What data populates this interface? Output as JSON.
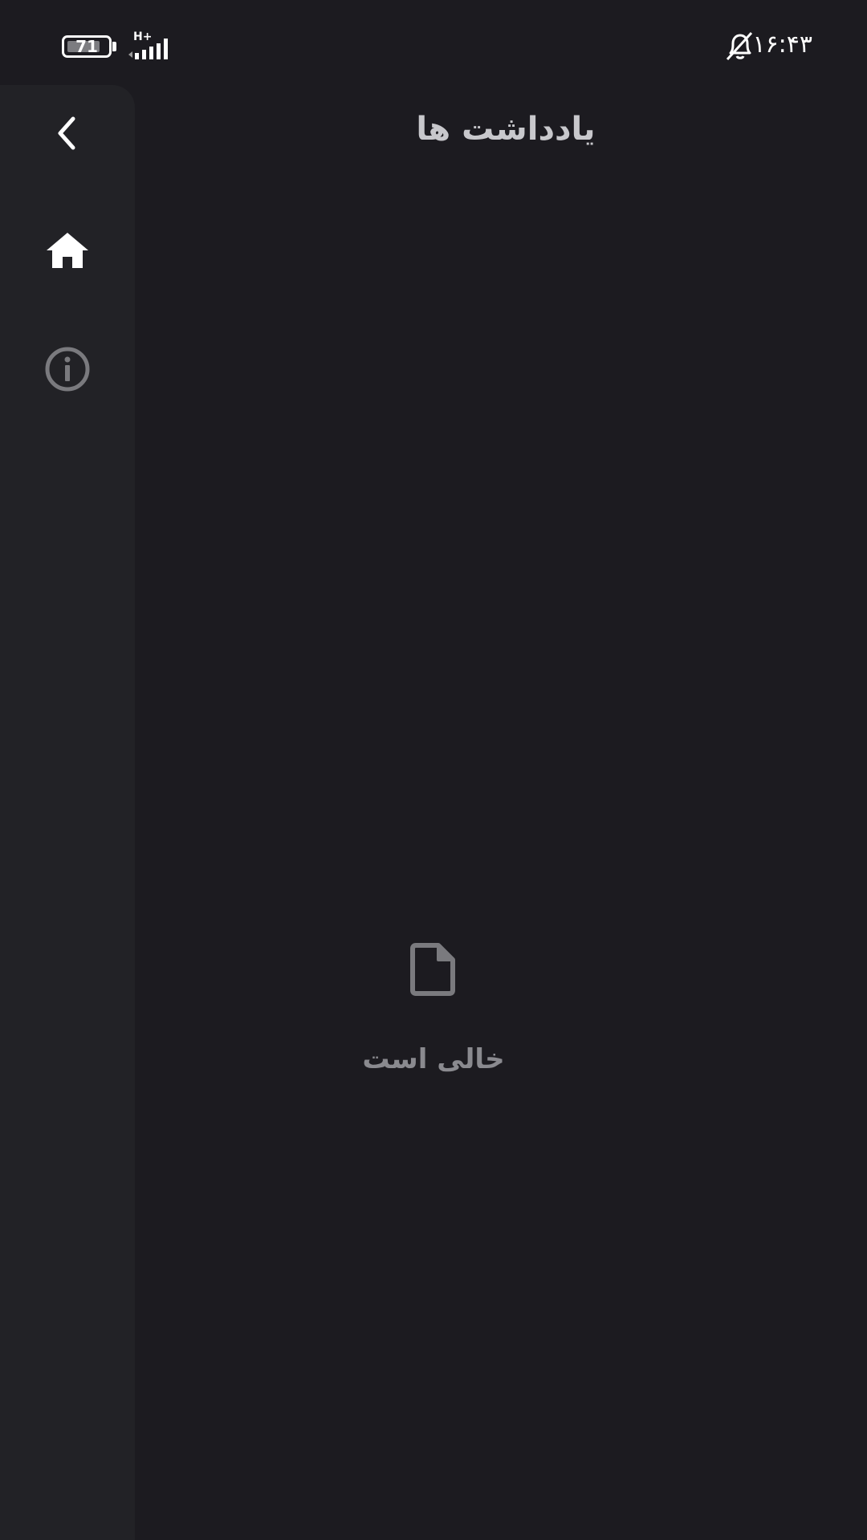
{
  "status_bar": {
    "battery_level": "71",
    "network_type": "H+",
    "time": "۱۶:۴۳",
    "icons": [
      "battery-icon",
      "signal-icon",
      "bell-off-icon"
    ]
  },
  "nav_rail": {
    "items": [
      {
        "icon": "back-chevron-icon"
      },
      {
        "icon": "home-icon",
        "active": true
      },
      {
        "icon": "info-icon",
        "active": false
      }
    ]
  },
  "header": {
    "title": "یادداشت ها"
  },
  "empty_state": {
    "icon": "document-icon",
    "message": "خالی است"
  },
  "colors": {
    "background": "#1c1b20",
    "rail": "#222226",
    "active_icon": "#ffffff",
    "inactive_icon": "#7a7a7e",
    "title": "#c8c8cc",
    "muted_text": "#8a8a8f"
  }
}
